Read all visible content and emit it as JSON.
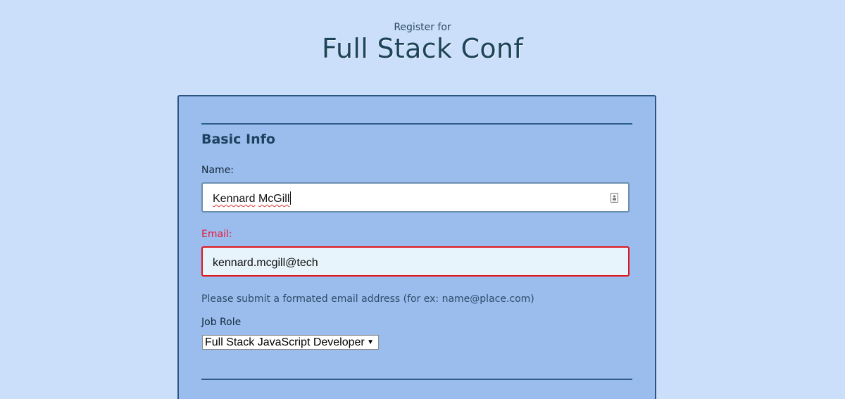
{
  "header": {
    "subtitle": "Register for",
    "title": "Full Stack Conf"
  },
  "form": {
    "section_title": "Basic Info",
    "name": {
      "label": "Name:",
      "value_first": "Kennard",
      "value_last": "McGill"
    },
    "email": {
      "label": "Email:",
      "value": "kennard.mcgill@tech",
      "error_hint": "Please submit a formated email address (for ex: name@place.com)"
    },
    "job_role": {
      "label": "Job Role",
      "selected": "Full Stack JavaScript Developer"
    }
  },
  "colors": {
    "page_background": "#cbdffa",
    "panel_background": "#9bbdee",
    "error_red": "#e0161d",
    "title_color": "#1e4459"
  },
  "icons": {
    "autofill": "contact-card-icon",
    "select_arrow": "dropdown-arrow-icon"
  }
}
